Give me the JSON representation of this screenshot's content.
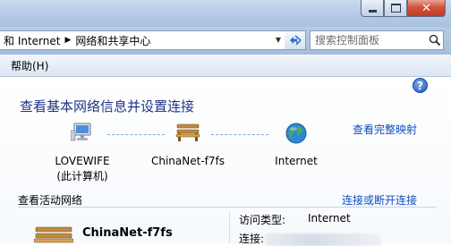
{
  "window": {
    "minimize_icon": "minimize-icon",
    "maximize_icon": "maximize-icon",
    "close_icon": "close-icon"
  },
  "address": {
    "crumbs": [
      "和 Internet",
      "网络和共享中心"
    ],
    "search_placeholder": "搜索控制面板"
  },
  "menu": {
    "items": [
      "帮助(H)"
    ]
  },
  "main": {
    "title": "查看基本网络信息并设置连接",
    "full_map_link": "查看完整映射",
    "nodes": [
      {
        "label": "LOVEWIFE",
        "sublabel": "(此计算机)",
        "icon": "computer-icon"
      },
      {
        "label": "ChinaNet-f7fs",
        "icon": "bench-network-icon"
      },
      {
        "label": "Internet",
        "icon": "globe-icon"
      }
    ],
    "active_section_label": "查看活动网络",
    "connect_link": "连接或断开连接",
    "active_network": {
      "name": "ChinaNet-f7fs",
      "icon": "bench-network-icon",
      "access_type_label": "访问类型:",
      "access_type_value": "Internet",
      "connections_label": "连接:"
    }
  },
  "colors": {
    "link": "#0f4dbe",
    "title": "#1e3287",
    "titlebar": "#b7cce6"
  }
}
